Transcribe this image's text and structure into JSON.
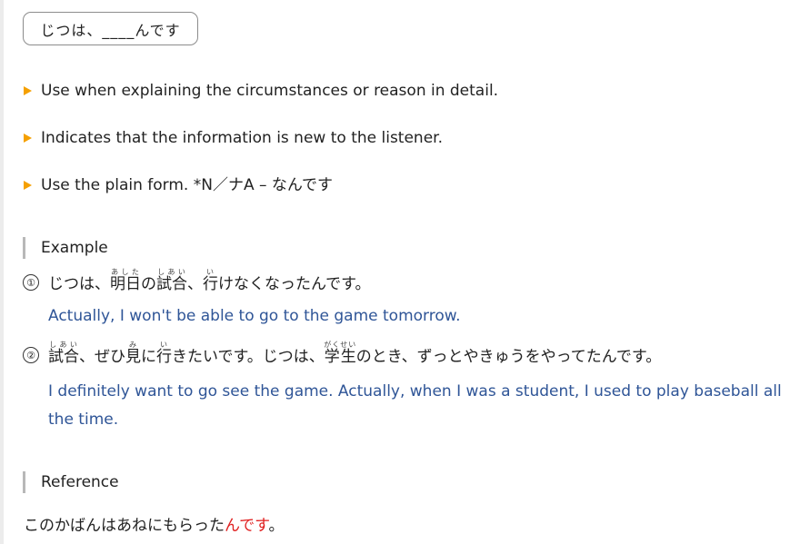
{
  "pattern": {
    "text": "じつは、____んです"
  },
  "bullets": [
    "Use when explaining the circumstances or reason in detail.",
    "Indicates that the information is new to the listener.",
    "Use the plain form. *N／ナA – なんです"
  ],
  "example": {
    "heading": "Example",
    "items": [
      {
        "num": "①",
        "jp": {
          "p1": "じつは、",
          "r1": {
            "base": "明日",
            "rt": "あした"
          },
          "p2": "の",
          "r2": {
            "base": "試合",
            "rt": "しあい"
          },
          "p3": "、",
          "r3": {
            "base": "行",
            "rt": "い"
          },
          "p4": "けなくなったんです。"
        },
        "en": "Actually, I won't be able to go to the game tomorrow."
      },
      {
        "num": "②",
        "jp": {
          "r1": {
            "base": "試合",
            "rt": "しあい"
          },
          "p1": "、ぜひ",
          "r2": {
            "base": "見",
            "rt": "み"
          },
          "p2": "に",
          "r3": {
            "base": "行",
            "rt": "い"
          },
          "p3": "きたいです。じつは、",
          "r4": {
            "base": "学生",
            "rt": "がくせい"
          },
          "p4": "のとき、ずっとやきゅうをやってたんです。"
        },
        "en": "I definitely want to go see the game. Actually, when I was a student, I used to play baseball all the time."
      }
    ]
  },
  "reference": {
    "heading": "Reference",
    "sentence_before": "このかばんはあねにもらった",
    "sentence_highlight": "んです",
    "sentence_after": "。"
  },
  "colors": {
    "bullet_marker": "#f5a000",
    "translation": "#2f5597",
    "highlight": "#e02020"
  }
}
